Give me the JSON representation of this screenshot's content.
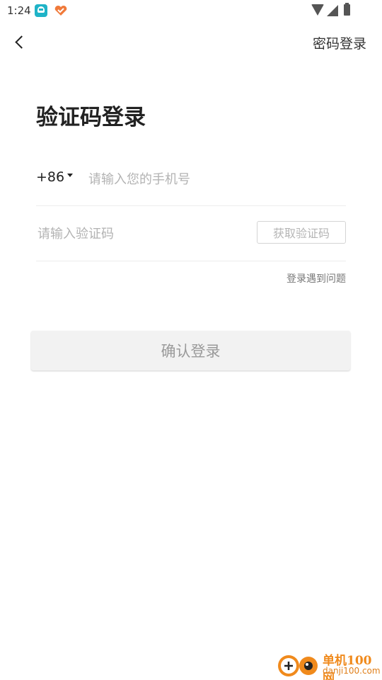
{
  "status_bar": {
    "time": "1:24",
    "icons": [
      "app-notification-icon",
      "app-heart-icon",
      "wifi-icon",
      "signal-icon",
      "battery-icon"
    ]
  },
  "nav": {
    "back_icon": "chevron-left-icon",
    "password_login_label": "密码登录"
  },
  "title": "验证码登录",
  "phone": {
    "country_code": "+86",
    "placeholder": "请输入您的手机号",
    "value": ""
  },
  "code": {
    "placeholder": "请输入验证码",
    "value": "",
    "get_code_label": "获取验证码"
  },
  "login_help_label": "登录遇到问题",
  "confirm_button_label": "确认登录",
  "watermark": {
    "name": "单机100网",
    "url": "danji100.com"
  },
  "colors": {
    "accent_watermark": "#f08a1c",
    "placeholder": "#b3b3b3",
    "button_disabled_bg": "#f2f2f2",
    "app_icon_teal": "#1fb3c7"
  }
}
